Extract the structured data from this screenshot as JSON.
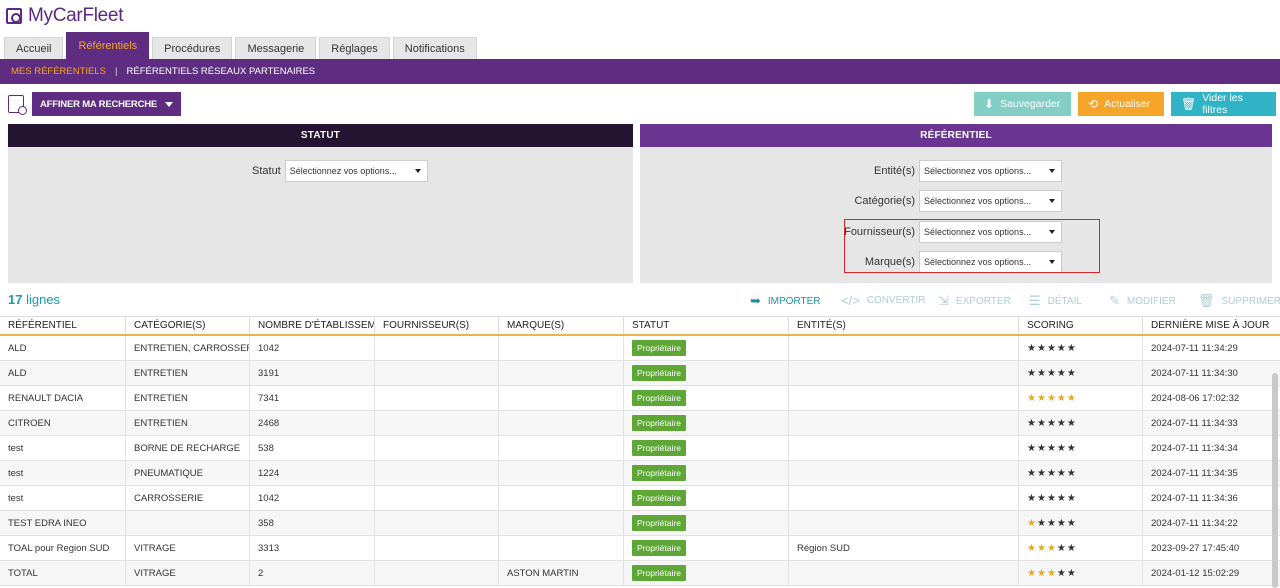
{
  "app": {
    "title": "MyCarFleet"
  },
  "tabs": [
    {
      "label": "Accueil",
      "active": false
    },
    {
      "label": "Référentiels",
      "active": true
    },
    {
      "label": "Procédures",
      "active": false
    },
    {
      "label": "Messagerie",
      "active": false
    },
    {
      "label": "Réglages",
      "active": false
    },
    {
      "label": "Notifications",
      "active": false
    }
  ],
  "subnav": {
    "mine": "MES RÉFÉRENTIELS",
    "separator": "|",
    "partners": "RÉFÉRENTIELS RÉSEAUX PARTENAIRES"
  },
  "toolbar": {
    "refine": "AFFINER MA RECHERCHE",
    "save": "Sauvegarder",
    "refresh": "Actualiser",
    "clear": "Vider les filtres"
  },
  "panels": {
    "statut": {
      "title": "STATUT",
      "label": "Statut",
      "placeholder": "Sélectionnez vos options..."
    },
    "referentiel": {
      "title": "RÉFÉRENTIEL",
      "filters": [
        {
          "label": "Entité(s)",
          "value": "Sélectionnez vos options..."
        },
        {
          "label": "Catégorie(s)",
          "value": "Sélectionnez vos options..."
        },
        {
          "label": "Fournisseur(s)",
          "value": "Sélectionnez vos options..."
        },
        {
          "label": "Marque(s)",
          "value": "Sélectionnez vos options..."
        }
      ]
    }
  },
  "list": {
    "count": "17",
    "count_label": "lignes"
  },
  "actions": {
    "import": "IMPORTER",
    "convert": "CONVERTIR",
    "export": "EXPORTER",
    "detail": "DÉTAIL",
    "edit": "MODIFIER",
    "delete": "SUPPRIMER"
  },
  "table": {
    "headers": [
      "RÉFÉRENTIEL",
      "CATÉGORIE(S)",
      "NOMBRE D'ÉTABLISSEMENTS",
      "FOURNISSEUR(S)",
      "MARQUE(S)",
      "STATUT",
      "ENTITÉ(S)",
      "SCORING",
      "DERNIÈRE MISE À JOUR"
    ],
    "rows": [
      {
        "ref": "ALD",
        "cat": "ENTRETIEN, CARROSSERIE",
        "nb": "1042",
        "four": "",
        "marque": "",
        "statut": "Propriétaire",
        "entite": "",
        "score": 5,
        "score_color": "dark",
        "date": "2024-07-11 11:34:29"
      },
      {
        "ref": "ALD",
        "cat": "ENTRETIEN",
        "nb": "3191",
        "four": "",
        "marque": "",
        "statut": "Propriétaire",
        "entite": "",
        "score": 5,
        "score_color": "dark",
        "date": "2024-07-11 11:34:30"
      },
      {
        "ref": "RENAULT DACIA",
        "cat": "ENTRETIEN",
        "nb": "7341",
        "four": "",
        "marque": "",
        "statut": "Propriétaire",
        "entite": "",
        "score": 5,
        "score_color": "gold",
        "date": "2024-08-06 17:02:32"
      },
      {
        "ref": "CITROEN",
        "cat": "ENTRETIEN",
        "nb": "2468",
        "four": "",
        "marque": "",
        "statut": "Propriétaire",
        "entite": "",
        "score": 5,
        "score_color": "dark",
        "date": "2024-07-11 11:34:33"
      },
      {
        "ref": "test",
        "cat": "BORNE DE RECHARGE",
        "nb": "538",
        "four": "",
        "marque": "",
        "statut": "Propriétaire",
        "entite": "",
        "score": 5,
        "score_color": "dark",
        "date": "2024-07-11 11:34:34"
      },
      {
        "ref": "test",
        "cat": "PNEUMATIQUE",
        "nb": "1224",
        "four": "",
        "marque": "",
        "statut": "Propriétaire",
        "entite": "",
        "score": 5,
        "score_color": "dark",
        "date": "2024-07-11 11:34:35"
      },
      {
        "ref": "test",
        "cat": "CARROSSERIE",
        "nb": "1042",
        "four": "",
        "marque": "",
        "statut": "Propriétaire",
        "entite": "",
        "score": 5,
        "score_color": "dark",
        "date": "2024-07-11 11:34:36"
      },
      {
        "ref": "TEST EDRA INEO",
        "cat": "",
        "nb": "358",
        "four": "",
        "marque": "",
        "statut": "Propriétaire",
        "entite": "",
        "score": 1,
        "score_color": "mixed",
        "date": "2024-07-11 11:34:22"
      },
      {
        "ref": "TOAL pour Region SUD",
        "cat": "VITRAGE",
        "nb": "3313",
        "four": "",
        "marque": "",
        "statut": "Propriétaire",
        "entite": "Région SUD",
        "score": 3,
        "score_color": "mixed",
        "date": "2023-09-27 17:45:40"
      },
      {
        "ref": "TOTAL",
        "cat": "VITRAGE",
        "nb": "2",
        "four": "",
        "marque": "ASTON MARTIN",
        "statut": "Propriétaire",
        "entite": "",
        "score": 3,
        "score_color": "mixed",
        "date": "2024-01-12 15:02:29"
      }
    ]
  }
}
